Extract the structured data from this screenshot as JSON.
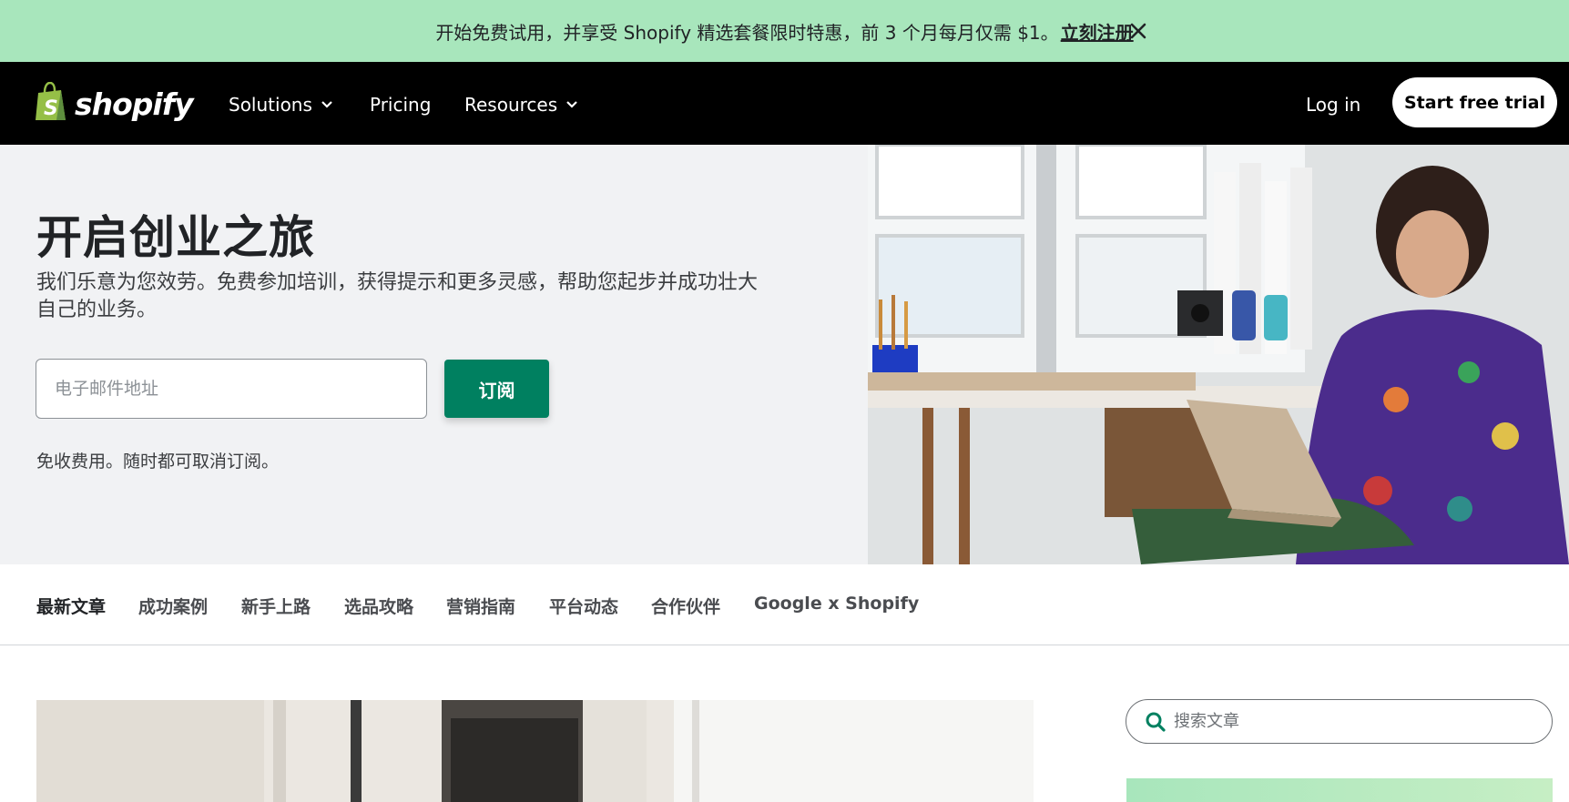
{
  "promo": {
    "text": "开始免费试用，并享受 Shopify 精选套餐限时特惠，前 3 个月每月仅需 $1。",
    "link": "立刻注册",
    "close_icon": "close-icon"
  },
  "nav": {
    "logo_text": "shopify",
    "items": [
      {
        "label": "Solutions",
        "icon": "chevron-down-icon"
      },
      {
        "label": "Pricing"
      },
      {
        "label": "Resources",
        "icon": "chevron-down-icon"
      }
    ],
    "login": "Log in",
    "trial_button": "Start free trial"
  },
  "hero": {
    "title": "开启创业之旅",
    "subtitle": "我们乐意为您效劳。免费参加培训，获得提示和更多灵感，帮助您起步并成功壮大自己的业务。",
    "email_placeholder": "电子邮件地址",
    "subscribe_button": "订阅",
    "note": "免收费用。随时都可取消订阅。"
  },
  "categories": [
    {
      "label": "最新文章",
      "active": true
    },
    {
      "label": "成功案例",
      "active": false
    },
    {
      "label": "新手上路",
      "active": false
    },
    {
      "label": "选品攻略",
      "active": false
    },
    {
      "label": "营销指南",
      "active": false
    },
    {
      "label": "平台动态",
      "active": false
    },
    {
      "label": "合作伙伴",
      "active": false
    },
    {
      "label": "Google x Shopify",
      "active": false
    }
  ],
  "search": {
    "placeholder": "搜索文章",
    "icon": "search-icon"
  },
  "colors": {
    "promo_bg": "#a8e6bc",
    "nav_bg": "#000000",
    "accent": "#008060",
    "hero_bg": "#f1f2f4"
  }
}
